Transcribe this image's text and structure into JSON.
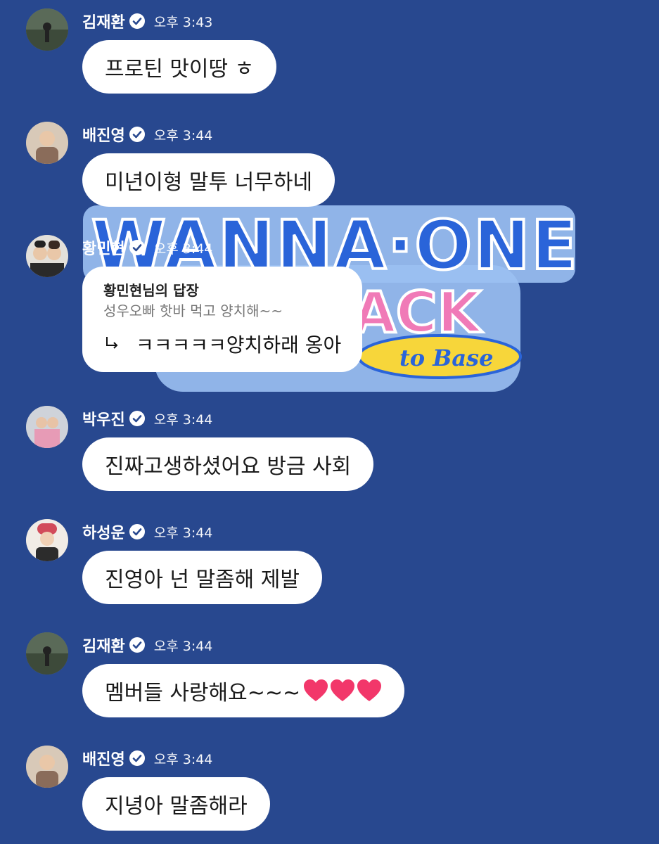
{
  "colors": {
    "background": "#28488f",
    "bubble": "#ffffff",
    "logo_blue": "#2a64d9",
    "logo_pink": "#f07ab7",
    "logo_yellow": "#f7d63a"
  },
  "background_logo": {
    "line1": "WANNA·ONE",
    "line2": "BACK",
    "line3": "to Base"
  },
  "messages": [
    {
      "name": "김재환",
      "time": "오후 3:43",
      "text": "프로틴 맛이땅 ㅎ",
      "avatar": "avatar-photo"
    },
    {
      "name": "배진영",
      "time": "오후 3:44",
      "text": "미년이형 말투 너무하네",
      "avatar": "avatar-photo"
    },
    {
      "name": "황민현",
      "time": "오후 3:44",
      "reply_to": "황민현님의 답장",
      "quote": "성우오빠 핫바 먹고 양치해~~",
      "text": "ㅋㅋㅋㅋㅋ양치하래 옹아",
      "avatar": "avatar-photo"
    },
    {
      "name": "박우진",
      "time": "오후 3:44",
      "text": "진짜고생하셨어요 방금 사회",
      "avatar": "avatar-photo"
    },
    {
      "name": "하성운",
      "time": "오후 3:44",
      "text": "진영아 넌 말좀해 제발",
      "avatar": "avatar-photo"
    },
    {
      "name": "김재환",
      "time": "오후 3:44",
      "text": "멤버들 사랑해요~~~",
      "hearts": "heart-icon ×3",
      "avatar": "avatar-photo"
    },
    {
      "name": "배진영",
      "time": "오후 3:44",
      "text": "지녕아 말좀해라",
      "avatar": "avatar-photo"
    }
  ]
}
